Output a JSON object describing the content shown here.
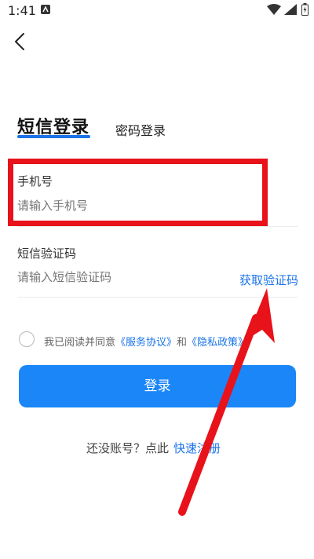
{
  "status_bar": {
    "time": "1:41"
  },
  "tabs": {
    "sms_login": "短信登录",
    "password_login": "密码登录"
  },
  "phone_field": {
    "label": "手机号",
    "placeholder": "请输入手机号"
  },
  "code_field": {
    "label": "短信验证码",
    "placeholder": "请输入短信验证码",
    "get_code": "获取验证码"
  },
  "agreement": {
    "prefix": "我已阅读并同意",
    "service": "《服务协议》",
    "and": "和",
    "privacy": "《隐私政策》"
  },
  "login_button": "登录",
  "register": {
    "prompt": "还没账号？点此",
    "link": "快速注册"
  },
  "colors": {
    "accent": "#1a73e8",
    "button": "#1a86f8",
    "highlight": "#e8121a"
  },
  "icons": {
    "back": "chevron-left-icon",
    "wifi": "wifi-icon",
    "signal": "signal-icon",
    "battery": "battery-icon"
  }
}
